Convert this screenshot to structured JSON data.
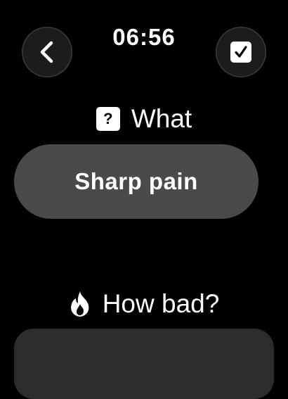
{
  "status": {
    "time": "06:56"
  },
  "header": {
    "back_icon": "chevron-left-icon",
    "done_icon": "checkbox-checked-icon"
  },
  "what": {
    "icon": "question-mark-icon",
    "question_glyph": "?",
    "label": "What",
    "selected_value": "Sharp pain"
  },
  "how_bad": {
    "icon": "flame-icon",
    "label": "How bad?"
  },
  "colors": {
    "background": "#000000",
    "pill": "#4a4a4a",
    "button": "#1c1c1e",
    "text": "#ffffff"
  }
}
